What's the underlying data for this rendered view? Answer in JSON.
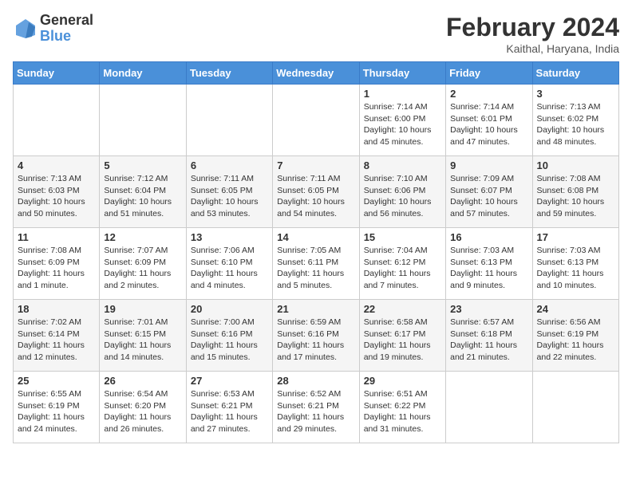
{
  "header": {
    "logo_general": "General",
    "logo_blue": "Blue",
    "month_title": "February 2024",
    "location": "Kaithal, Haryana, India"
  },
  "days_of_week": [
    "Sunday",
    "Monday",
    "Tuesday",
    "Wednesday",
    "Thursday",
    "Friday",
    "Saturday"
  ],
  "weeks": [
    [
      {
        "day": "",
        "info": ""
      },
      {
        "day": "",
        "info": ""
      },
      {
        "day": "",
        "info": ""
      },
      {
        "day": "",
        "info": ""
      },
      {
        "day": "1",
        "info": "Sunrise: 7:14 AM\nSunset: 6:00 PM\nDaylight: 10 hours\nand 45 minutes."
      },
      {
        "day": "2",
        "info": "Sunrise: 7:14 AM\nSunset: 6:01 PM\nDaylight: 10 hours\nand 47 minutes."
      },
      {
        "day": "3",
        "info": "Sunrise: 7:13 AM\nSunset: 6:02 PM\nDaylight: 10 hours\nand 48 minutes."
      }
    ],
    [
      {
        "day": "4",
        "info": "Sunrise: 7:13 AM\nSunset: 6:03 PM\nDaylight: 10 hours\nand 50 minutes."
      },
      {
        "day": "5",
        "info": "Sunrise: 7:12 AM\nSunset: 6:04 PM\nDaylight: 10 hours\nand 51 minutes."
      },
      {
        "day": "6",
        "info": "Sunrise: 7:11 AM\nSunset: 6:05 PM\nDaylight: 10 hours\nand 53 minutes."
      },
      {
        "day": "7",
        "info": "Sunrise: 7:11 AM\nSunset: 6:05 PM\nDaylight: 10 hours\nand 54 minutes."
      },
      {
        "day": "8",
        "info": "Sunrise: 7:10 AM\nSunset: 6:06 PM\nDaylight: 10 hours\nand 56 minutes."
      },
      {
        "day": "9",
        "info": "Sunrise: 7:09 AM\nSunset: 6:07 PM\nDaylight: 10 hours\nand 57 minutes."
      },
      {
        "day": "10",
        "info": "Sunrise: 7:08 AM\nSunset: 6:08 PM\nDaylight: 10 hours\nand 59 minutes."
      }
    ],
    [
      {
        "day": "11",
        "info": "Sunrise: 7:08 AM\nSunset: 6:09 PM\nDaylight: 11 hours\nand 1 minute."
      },
      {
        "day": "12",
        "info": "Sunrise: 7:07 AM\nSunset: 6:09 PM\nDaylight: 11 hours\nand 2 minutes."
      },
      {
        "day": "13",
        "info": "Sunrise: 7:06 AM\nSunset: 6:10 PM\nDaylight: 11 hours\nand 4 minutes."
      },
      {
        "day": "14",
        "info": "Sunrise: 7:05 AM\nSunset: 6:11 PM\nDaylight: 11 hours\nand 5 minutes."
      },
      {
        "day": "15",
        "info": "Sunrise: 7:04 AM\nSunset: 6:12 PM\nDaylight: 11 hours\nand 7 minutes."
      },
      {
        "day": "16",
        "info": "Sunrise: 7:03 AM\nSunset: 6:13 PM\nDaylight: 11 hours\nand 9 minutes."
      },
      {
        "day": "17",
        "info": "Sunrise: 7:03 AM\nSunset: 6:13 PM\nDaylight: 11 hours\nand 10 minutes."
      }
    ],
    [
      {
        "day": "18",
        "info": "Sunrise: 7:02 AM\nSunset: 6:14 PM\nDaylight: 11 hours\nand 12 minutes."
      },
      {
        "day": "19",
        "info": "Sunrise: 7:01 AM\nSunset: 6:15 PM\nDaylight: 11 hours\nand 14 minutes."
      },
      {
        "day": "20",
        "info": "Sunrise: 7:00 AM\nSunset: 6:16 PM\nDaylight: 11 hours\nand 15 minutes."
      },
      {
        "day": "21",
        "info": "Sunrise: 6:59 AM\nSunset: 6:16 PM\nDaylight: 11 hours\nand 17 minutes."
      },
      {
        "day": "22",
        "info": "Sunrise: 6:58 AM\nSunset: 6:17 PM\nDaylight: 11 hours\nand 19 minutes."
      },
      {
        "day": "23",
        "info": "Sunrise: 6:57 AM\nSunset: 6:18 PM\nDaylight: 11 hours\nand 21 minutes."
      },
      {
        "day": "24",
        "info": "Sunrise: 6:56 AM\nSunset: 6:19 PM\nDaylight: 11 hours\nand 22 minutes."
      }
    ],
    [
      {
        "day": "25",
        "info": "Sunrise: 6:55 AM\nSunset: 6:19 PM\nDaylight: 11 hours\nand 24 minutes."
      },
      {
        "day": "26",
        "info": "Sunrise: 6:54 AM\nSunset: 6:20 PM\nDaylight: 11 hours\nand 26 minutes."
      },
      {
        "day": "27",
        "info": "Sunrise: 6:53 AM\nSunset: 6:21 PM\nDaylight: 11 hours\nand 27 minutes."
      },
      {
        "day": "28",
        "info": "Sunrise: 6:52 AM\nSunset: 6:21 PM\nDaylight: 11 hours\nand 29 minutes."
      },
      {
        "day": "29",
        "info": "Sunrise: 6:51 AM\nSunset: 6:22 PM\nDaylight: 11 hours\nand 31 minutes."
      },
      {
        "day": "",
        "info": ""
      },
      {
        "day": "",
        "info": ""
      }
    ]
  ]
}
